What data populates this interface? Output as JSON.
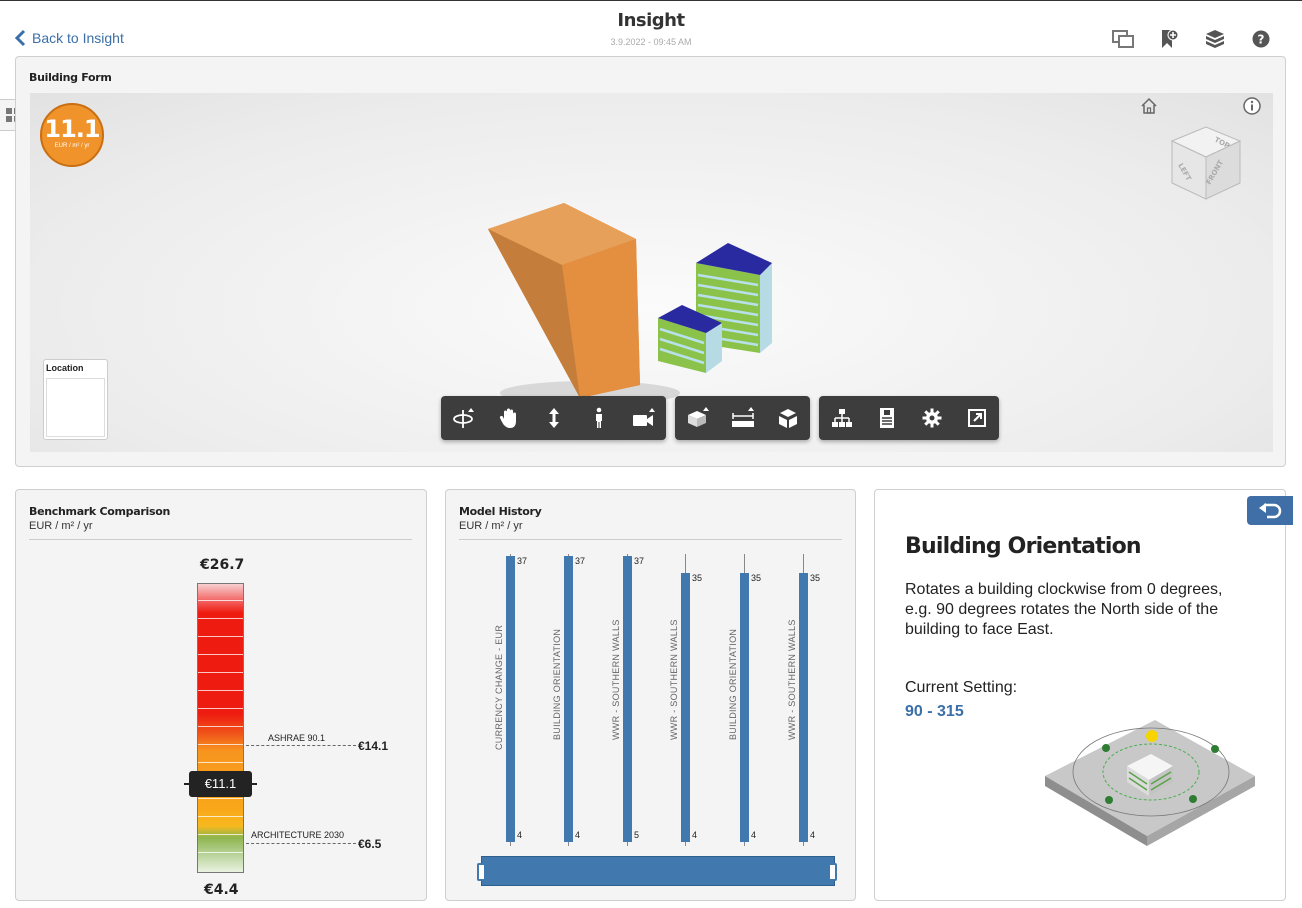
{
  "header": {
    "back_label": "Back to Insight",
    "title": "Insight",
    "date": "3.9.2022 - 09:45 AM",
    "icons": [
      "compare-icon",
      "bookmark-add-icon",
      "layers-icon",
      "help-icon"
    ]
  },
  "building_form": {
    "title": "Building Form",
    "score_value": "11.1",
    "score_unit": "EUR / m² / yr",
    "location_label": "Location",
    "viewcube_faces": [
      "TOP",
      "LEFT",
      "FRONT"
    ],
    "toolbar_groups": [
      [
        "orbit-icon",
        "pan-icon",
        "zoom-icon",
        "walk-icon",
        "camera-icon"
      ],
      [
        "section-icon",
        "measure-icon",
        "explode-icon"
      ],
      [
        "model-browser-icon",
        "properties-icon",
        "settings-icon",
        "fullscreen-icon"
      ]
    ]
  },
  "benchmark": {
    "title": "Benchmark Comparison",
    "unit": "EUR / m² / yr",
    "max_label": "€26.7",
    "min_label": "€4.4",
    "current_label": "€11.1",
    "current_value": 11.1,
    "refs": [
      {
        "name": "ASHRAE 90.1",
        "value_label": "€14.1"
      },
      {
        "name": "ARCHITECTURE 2030",
        "value_label": "€6.5"
      }
    ]
  },
  "model_history": {
    "title": "Model History",
    "unit": "EUR / m² / yr",
    "entries": [
      {
        "label": "CURRENCY CHANGE - EUR",
        "high": 37,
        "low": 4
      },
      {
        "label": "BUILDING ORIENTATION",
        "high": 37,
        "low": 4
      },
      {
        "label": "WWR - SOUTHERN WALLS",
        "high": 37,
        "low": 5
      },
      {
        "label": "WWR - SOUTHERN WALLS",
        "high": 35,
        "low": 4
      },
      {
        "label": "BUILDING ORIENTATION",
        "high": 35,
        "low": 4
      },
      {
        "label": "WWR - SOUTHERN WALLS",
        "high": 35,
        "low": 4
      }
    ]
  },
  "orientation": {
    "title": "Building Orientation",
    "description": "Rotates a building clockwise from 0 degrees, e.g. 90 degrees rotates the North side of the building to face East.",
    "current_label": "Current Setting:",
    "current_value": "90 - 315"
  },
  "colors": {
    "accent": "#3a6fa8",
    "bar_blue": "#4178ae",
    "score_orange": "#f0932b"
  }
}
